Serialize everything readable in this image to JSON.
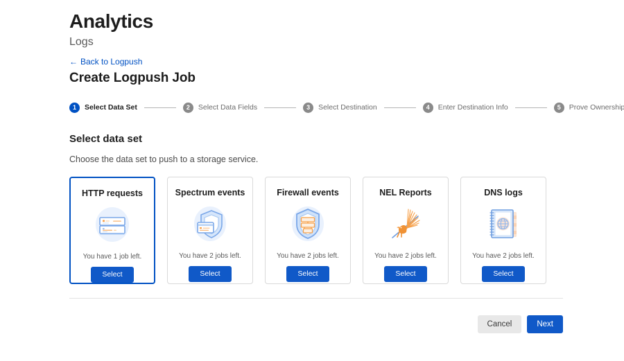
{
  "header": {
    "app_title": "Analytics",
    "app_subtitle": "Logs",
    "back_link": "Back to Logpush",
    "back_arrow": "←",
    "page_title": "Create Logpush Job"
  },
  "stepper": {
    "steps": [
      {
        "number": "1",
        "label": "Select Data Set",
        "active": true
      },
      {
        "number": "2",
        "label": "Select Data Fields",
        "active": false
      },
      {
        "number": "3",
        "label": "Select Destination",
        "active": false
      },
      {
        "number": "4",
        "label": "Enter Destination Info",
        "active": false
      },
      {
        "number": "5",
        "label": "Prove Ownership",
        "active": false
      }
    ]
  },
  "section": {
    "title": "Select data set",
    "description": "Choose the data set to push to a storage service."
  },
  "cards": [
    {
      "title": "HTTP requests",
      "icon": "server-rack-icon",
      "jobs_text": "You have 1 job left.",
      "select_label": "Select",
      "selected": true
    },
    {
      "title": "Spectrum events",
      "icon": "shield-card-icon",
      "jobs_text": "You have 2 jobs left.",
      "select_label": "Select",
      "selected": false
    },
    {
      "title": "Firewall events",
      "icon": "shield-brickwall-icon",
      "jobs_text": "You have 2 jobs left.",
      "select_label": "Select",
      "selected": false
    },
    {
      "title": "NEL Reports",
      "icon": "bird-burst-icon",
      "jobs_text": "You have 2 jobs left.",
      "select_label": "Select",
      "selected": false
    },
    {
      "title": "DNS logs",
      "icon": "notebook-globe-icon",
      "jobs_text": "You have 2 jobs left.",
      "select_label": "Select",
      "selected": false
    }
  ],
  "footer": {
    "cancel_label": "Cancel",
    "next_label": "Next"
  },
  "colors": {
    "accent_blue": "#0051c3",
    "button_blue": "#1059c8",
    "icon_blue": "#7aa7e8",
    "icon_blue_light": "#e8f0fd",
    "icon_orange": "#f6a04a",
    "step_inactive": "#8a8a8a",
    "border_gray": "#d9d9d9"
  }
}
